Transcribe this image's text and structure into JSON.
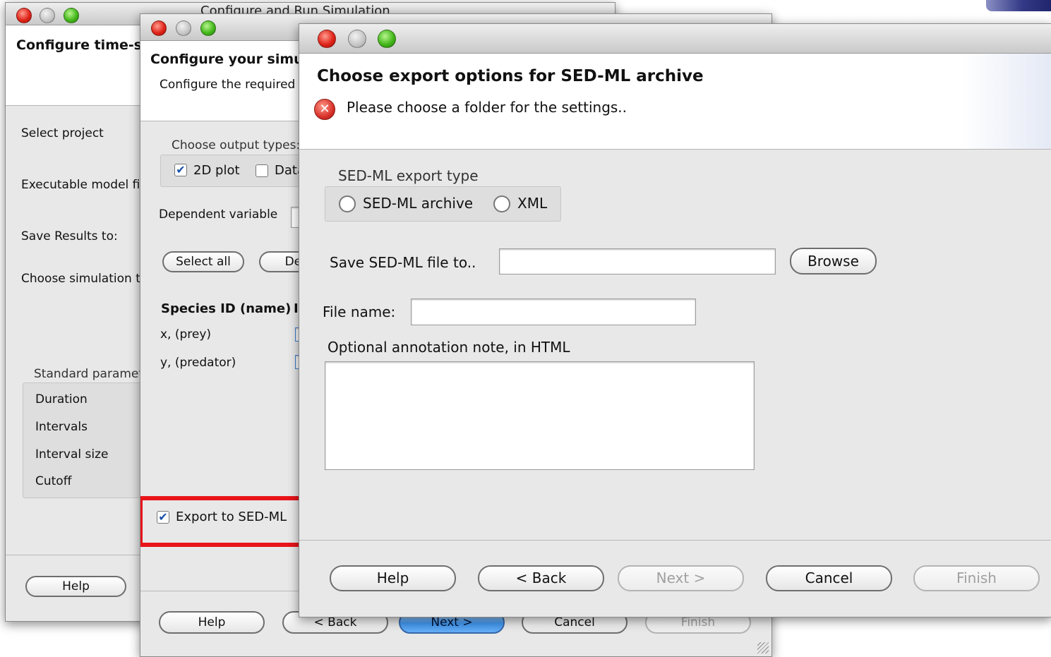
{
  "win1": {
    "title": "Configure and Run Simulation",
    "header_title": "Configure time-s",
    "labels": [
      "Select project",
      "Executable model fi",
      "Save Results to:",
      "Choose simulation t"
    ],
    "params_title": "Standard paramet",
    "params": [
      "Duration",
      "Intervals",
      "Interval size",
      "Cutoff"
    ],
    "help": "Help"
  },
  "win2": {
    "header_title": "Configure your simu",
    "header_sub": "Configure the required",
    "output_types_label": "Choose output types:",
    "plot2d_label": "2D plot",
    "plot2d_checked": true,
    "data_label": "Data",
    "data_checked": false,
    "dependent_label": "Dependent variable",
    "select_all": "Select all",
    "deselect": "Dese",
    "species_header": "Species ID (name)",
    "species": [
      "x, (prey)",
      "y, (predator)"
    ],
    "export_label": "Export to SED-ML",
    "export_checked": true,
    "highlight_color": "#e8141a",
    "buttons": {
      "help": "Help",
      "back": "< Back",
      "next": "Next >",
      "cancel": "Cancel",
      "finish": "Finish"
    }
  },
  "win3": {
    "header_title": "Choose export options for SED-ML archive",
    "error_message": "Please choose a folder for the settings..",
    "export_type_label": "SED-ML export type",
    "radio_archive": "SED-ML archive",
    "radio_xml": "XML",
    "save_to_label": "Save SED-ML file to..",
    "save_to_value": "",
    "browse": "Browse",
    "file_name_label": "File name:",
    "file_name_value": "",
    "annotation_label": "Optional annotation note, in HTML",
    "annotation_value": "",
    "buttons": {
      "help": "Help",
      "back": "< Back",
      "next": "Next >",
      "cancel": "Cancel",
      "finish": "Finish"
    }
  },
  "colors": {
    "error_icon": "#d8322a",
    "primary_button": "#3f95ec"
  },
  "icons": {
    "error": "error-x-icon",
    "check": "checkmark-icon"
  }
}
